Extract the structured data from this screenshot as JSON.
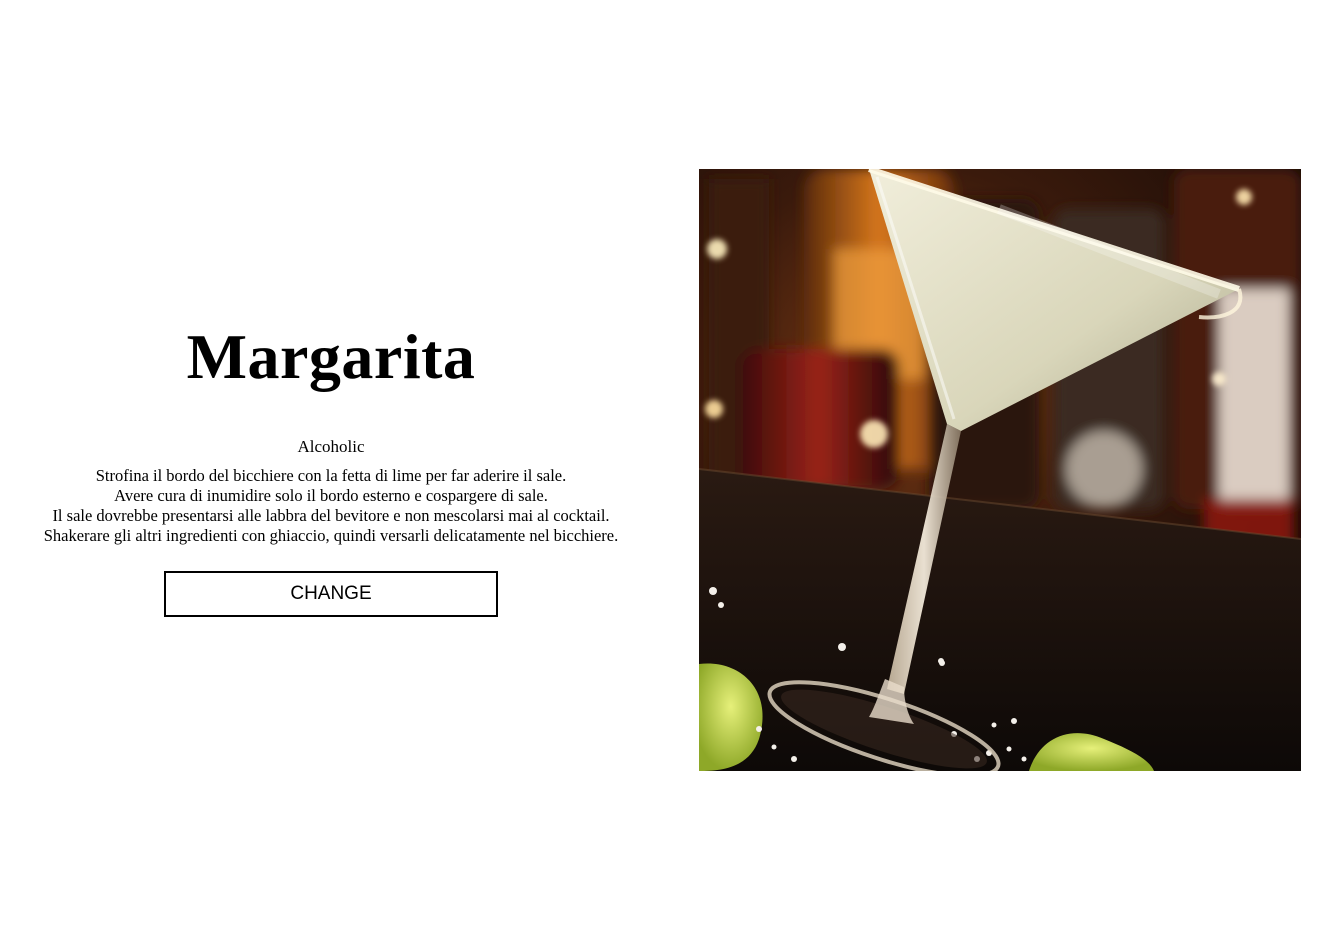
{
  "drink": {
    "name": "Margarita",
    "category": "Alcoholic",
    "instructions": [
      "Strofina il bordo del bicchiere con la fetta di lime per far aderire il sale.",
      "Avere cura di inumidire solo il bordo esterno e cospargere di sale.",
      "Il sale dovrebbe presentarsi alle labbra del bevitore e non mescolarsi mai al cocktail.",
      "Shakerare gli altri ingredienti con ghiaccio, quindi versarli delicatamente nel bicchiere."
    ],
    "image_alt": "cocktail-glass-photo"
  },
  "actions": {
    "change_label": "CHANGE"
  }
}
